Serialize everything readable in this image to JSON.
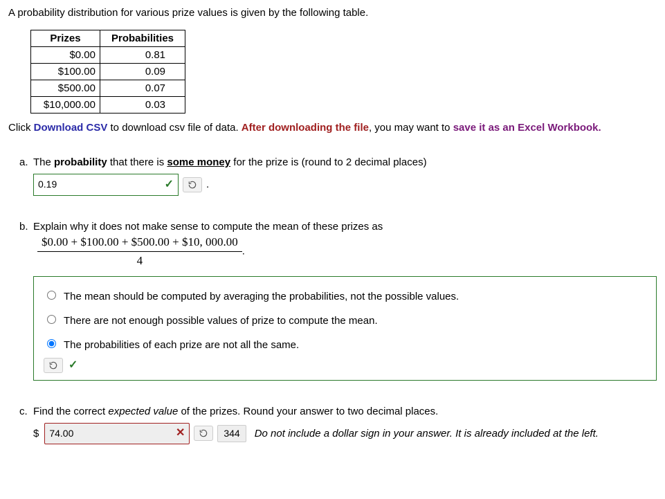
{
  "intro": "A probability distribution for various prize values is given by the following table.",
  "table": {
    "headers": [
      "Prizes",
      "Probabilities"
    ],
    "rows": [
      {
        "prize": "$0.00",
        "prob": "0.81"
      },
      {
        "prize": "$100.00",
        "prob": "0.09"
      },
      {
        "prize": "$500.00",
        "prob": "0.07"
      },
      {
        "prize": "$10,000.00",
        "prob": "0.03"
      }
    ]
  },
  "download": {
    "pre": "Click ",
    "link": "Download CSV",
    "mid": " to download csv file of data. ",
    "after": "After downloading the file",
    "tail1": ", you may want to ",
    "tail2": "save it as an Excel Workbook.",
    "period": ""
  },
  "qA": {
    "marker": "a.",
    "text1": "The ",
    "bold1": "probability",
    "text2": " that there is ",
    "underline": "some money",
    "text3": " for the prize is (round to 2 decimal places)",
    "answer": "0.19",
    "trailing": "."
  },
  "qB": {
    "marker": "b.",
    "lead": "Explain why it does not make sense to compute the mean of these prizes as",
    "numerator": "$0.00 + $100.00 + $500.00 + $10, 000.00",
    "denominator": "4",
    "frac_period": ".",
    "options": [
      "The mean should be computed by averaging the probabilities, not the possible values.",
      "There are not enough possible values of prize to compute the mean.",
      "The probabilities of each prize are not all the same."
    ],
    "selected": 2
  },
  "qC": {
    "marker": "c.",
    "lead1": "Find the correct ",
    "em": "expected value",
    "lead2": " of the prizes. Round your answer to two decimal places.",
    "dollar": "$",
    "answer": "74.00",
    "correct": "344",
    "hint": "Do not include a dollar sign in your answer. It is already included at the left."
  },
  "icons": {
    "check": "✓",
    "cross": "✕"
  }
}
